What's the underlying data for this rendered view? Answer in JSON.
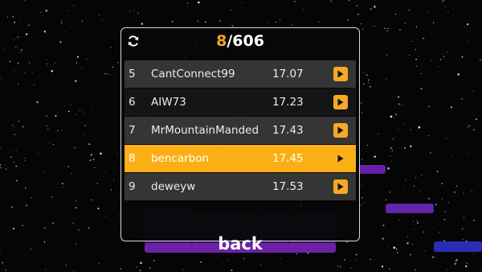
{
  "header": {
    "current_rank": "8",
    "total": "/606"
  },
  "leaderboard": [
    {
      "rank": "5",
      "name": "CantConnect99",
      "time": "17.07"
    },
    {
      "rank": "6",
      "name": "AIW73",
      "time": "17.23"
    },
    {
      "rank": "7",
      "name": "MrMountainManded",
      "time": "17.43"
    },
    {
      "rank": "8",
      "name": "bencarbon",
      "time": "17.45"
    },
    {
      "rank": "9",
      "name": "deweyw",
      "time": "17.53"
    }
  ],
  "highlighted_rank": "8",
  "back_label": "back",
  "colors": {
    "accent": "#f7a825",
    "highlight_row": "#fcaf14",
    "row_light": "#353535",
    "row_dark": "#151515",
    "purple_blocks": "#7a22b8",
    "blue_block": "#2f2fb8"
  },
  "icons": {
    "refresh": "refresh-icon",
    "play": "play-icon"
  }
}
